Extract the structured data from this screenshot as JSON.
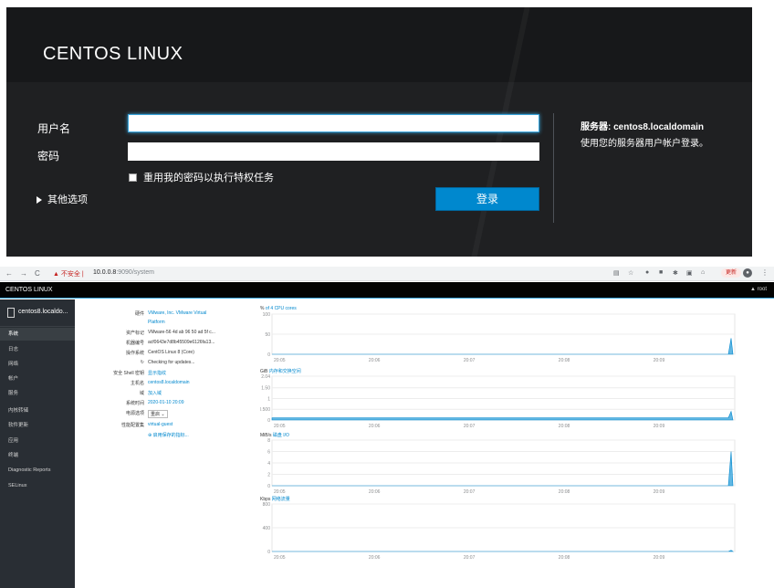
{
  "login": {
    "brand": "CENTOS LINUX",
    "username_label": "用户名",
    "username_value": "",
    "password_label": "密码",
    "password_value": "",
    "reuse_password_label": "重用我的密码以执行特权任务",
    "other_options_label": "其他选项",
    "login_button": "登录",
    "server_prefix": "服务器: ",
    "server_name": "centos8.localdomain",
    "server_hint": "使用您的服务器用户帐户登录。"
  },
  "browser": {
    "security_warning": "不安全",
    "url_host": "10.0.0.8",
    "url_path": ":9090/system",
    "update_badge": "更新"
  },
  "topbar": {
    "brand": "CENTOS LINUX",
    "user": "root"
  },
  "sidebar": {
    "host": "centos8.localdo...",
    "items": [
      {
        "label": "系统",
        "active": true
      },
      {
        "label": "日志",
        "active": false
      },
      {
        "label": "网络",
        "active": false
      },
      {
        "label": "帐户",
        "active": false
      },
      {
        "label": "服务",
        "active": false
      },
      {
        "label": "内核转储",
        "active": false
      },
      {
        "label": "软件更新",
        "active": false
      },
      {
        "label": "应用",
        "active": false
      },
      {
        "label": "终端",
        "active": false
      },
      {
        "label": "Diagnostic Reports",
        "active": false
      },
      {
        "label": "SELinux",
        "active": false
      }
    ]
  },
  "system_info": {
    "hardware_label": "硬件",
    "hardware_value": "VMware, Inc. VMware Virtual",
    "hardware_value2": "Platform",
    "asset_label": "资产标记",
    "asset_value": "VMware-56 4d ab 96 50 ad 5f c...",
    "machine_id_label": "机器编号",
    "machine_id_value": "acf0643e7d8b45509e6126fa13...",
    "os_label": "操作系统",
    "os_value": "CentOS Linux 8 (Core)",
    "updates_value": "Checking for updates...",
    "ssh_label": "安全 Shell 密钥",
    "ssh_value": "显示指纹",
    "hostname_label": "主机名",
    "hostname_value": "centos8.localdomain",
    "domain_label": "域",
    "domain_value": "加入域",
    "time_label": "系统时间",
    "time_value": "2020-01-10 20:09",
    "power_label": "电源选项",
    "power_value": "重启",
    "profile_label": "性能配置集",
    "profile_value": "virtual-guest",
    "enable_metrics": "启用保存的指标..."
  },
  "charts": [
    {
      "unit": "%",
      "title": "of 4 CPU cores",
      "yticks": [
        "100",
        "50",
        "0"
      ]
    },
    {
      "unit": "GiB",
      "title": "内存和交换空间",
      "yticks": [
        "2.04",
        "1.50",
        "1",
        "0.500",
        "0"
      ]
    },
    {
      "unit": "MiB/s",
      "title": "磁盘 I/O",
      "yticks": [
        "8",
        "6",
        "4",
        "2",
        "0"
      ]
    },
    {
      "unit": "Kbps",
      "title": "网络流量",
      "yticks": [
        "800",
        "400",
        "0"
      ]
    }
  ],
  "time_ticks": [
    "20:05",
    "20:06",
    "20:07",
    "20:08",
    "20:09"
  ],
  "chart_data": [
    {
      "type": "area",
      "title": "of 4 CPU cores",
      "ylabel": "%",
      "x": [
        "20:05",
        "20:06",
        "20:07",
        "20:08",
        "20:09"
      ],
      "ylim": [
        0,
        100
      ],
      "series": [
        {
          "values": [
            0,
            0,
            0,
            0,
            0,
            40
          ]
        }
      ]
    },
    {
      "type": "area",
      "title": "内存和交换空间",
      "ylabel": "GiB",
      "x": [
        "20:05",
        "20:06",
        "20:07",
        "20:08",
        "20:09"
      ],
      "ylim": [
        0,
        2.04
      ],
      "series": [
        {
          "values": [
            0.1,
            0.1,
            0.1,
            0.1,
            0.1,
            0.4
          ]
        }
      ]
    },
    {
      "type": "area",
      "title": "磁盘 I/O",
      "ylabel": "MiB/s",
      "x": [
        "20:05",
        "20:06",
        "20:07",
        "20:08",
        "20:09"
      ],
      "ylim": [
        0,
        8
      ],
      "series": [
        {
          "values": [
            0,
            0,
            0,
            0,
            0,
            6
          ]
        }
      ]
    },
    {
      "type": "area",
      "title": "网络流量",
      "ylabel": "Kbps",
      "x": [
        "20:05",
        "20:06",
        "20:07",
        "20:08",
        "20:09"
      ],
      "ylim": [
        0,
        800
      ],
      "series": [
        {
          "values": [
            0,
            0,
            0,
            0,
            0,
            20
          ]
        }
      ]
    }
  ],
  "colors": {
    "accent": "#0088ce",
    "login_bg": "#1f2022",
    "sidebar_bg": "#292e34",
    "chart_fill": "#39a5dc"
  }
}
